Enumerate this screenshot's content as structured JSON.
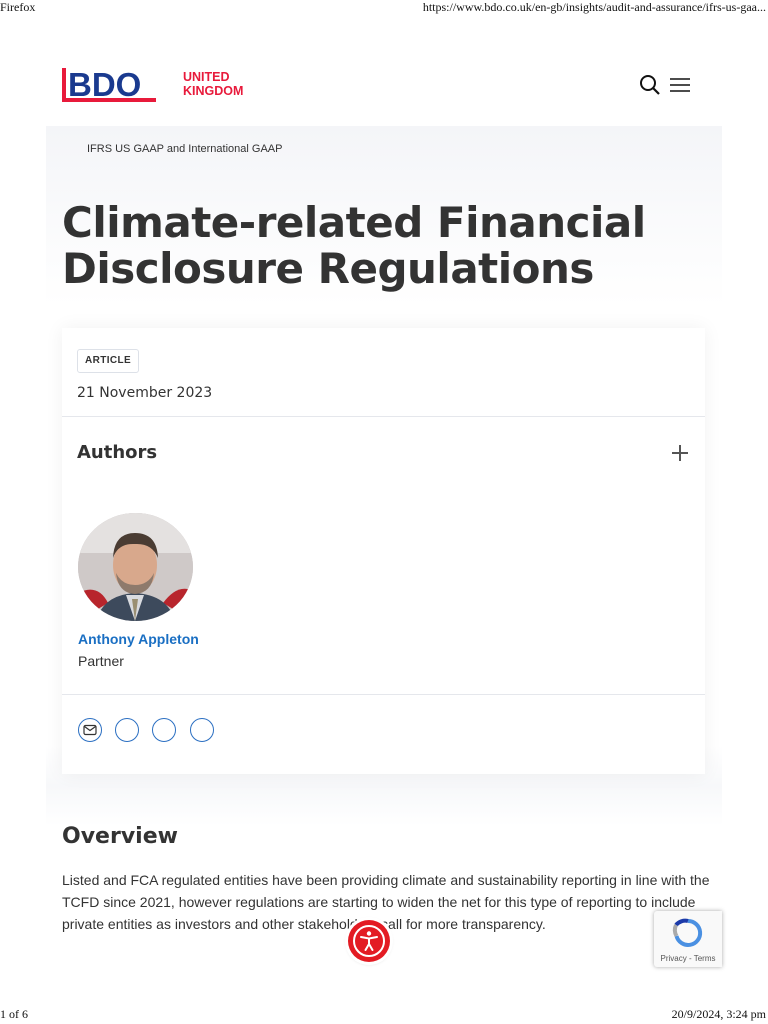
{
  "print_header": {
    "left": "Firefox",
    "right": "https://www.bdo.co.uk/en-gb/insights/audit-and-assurance/ifrs-us-gaa..."
  },
  "print_footer": {
    "left": "1 of 6",
    "right": "20/9/2024, 3:24 pm"
  },
  "header": {
    "logo_text": "BDO",
    "country_line1": "UNITED",
    "country_line2": "KINGDOM",
    "brand_blue": "#1a3a8f",
    "brand_red": "#e81a3b"
  },
  "breadcrumb": "IFRS US GAAP and International GAAP",
  "page_title": "Climate-related Financial Disclosure Regulations",
  "article": {
    "tag": "ARTICLE",
    "date": "21 November 2023",
    "authors_heading": "Authors",
    "author": {
      "name": "Anthony Appleton",
      "role": "Partner"
    },
    "share_icons": [
      "email-icon",
      "share-icon",
      "share-icon",
      "share-icon"
    ]
  },
  "overview": {
    "heading": "Overview",
    "paragraph": "Listed and FCA regulated entities have been providing climate and sustainability reporting in line with the TCFD since 2021, however regulations are starting to widen the net for this type of reporting to include private entities as investors and other stakeholders call for more transparency."
  },
  "recaptcha": {
    "links": "Privacy - Terms"
  }
}
